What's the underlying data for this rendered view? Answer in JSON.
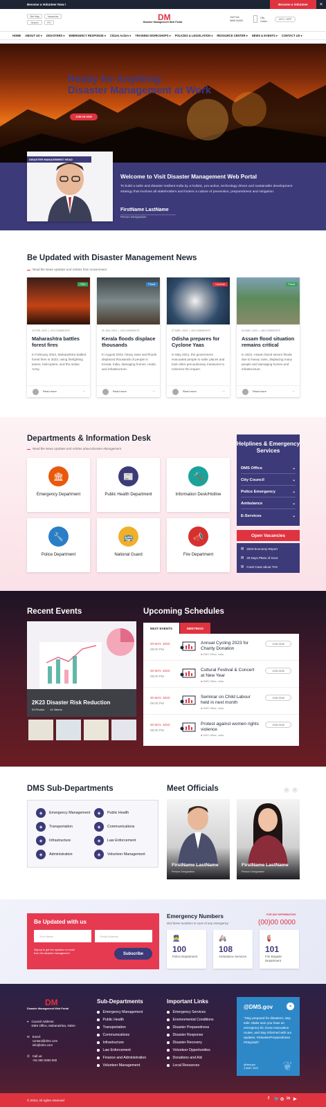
{
  "topbar": {
    "message": "Become a Volunteer Now !",
    "volunteer_btn": "Become a Volunteer",
    "close": "✕"
  },
  "header": {
    "buttons": [
      "Site Map",
      "Vacancies",
      "Search",
      "RTI"
    ],
    "logo": "DM",
    "logo_sub": "Disaster Management Web Portal",
    "tollfree_label": "Toll Free",
    "tollfree_number": "0808 00000",
    "city_label": "City",
    "city_value": "Carter",
    "weather": "24°C / 33°F"
  },
  "nav": [
    "HOME",
    "ABOUT US ▾",
    "DISASTERS ▾",
    "EMERGENCY RESPONSE ▾",
    "Citizen Action ▾",
    "TRAINING WORKSHOPS ▾",
    "POLICIES & LEGISLATION ▾",
    "RESOURCE CENTER ▾",
    "NEWS & EVENTS ▾",
    "CONTACT US ▾"
  ],
  "hero": {
    "line1": "Ready for Anything:",
    "line2": "Disaster Management at Work",
    "cta": "JOIN US NOW"
  },
  "head": {
    "tag": "DISASTER MANAGEMENT HEAD",
    "title": "Welcome to Visit Disaster Management Web Portal",
    "text": "To build a safer and disaster resilient India by a holistic, pro-active, technology driven and sustainable development strategy that involves all stakeholders and fosters a culture of prevention, preparedness and mitigation.",
    "name": "FirstName LastName",
    "designation": "Person Designation"
  },
  "news": {
    "title": "Be Updated with Disaster Management News",
    "subtitle": "Read the News Updates and Articles from Government",
    "items": [
      {
        "tag": "Fire",
        "tag_color": "#3aa35b",
        "date": "20 FEB, 2023",
        "comments": "470 COMMENTS",
        "title": "Maharashtra battles forest fires",
        "text": "In February 2023, Maharashtra battled forest fires in 2023, using firefighting teams, helicopters, and the Indian Army.",
        "read": "Read more"
      },
      {
        "tag": "Flood",
        "tag_color": "#3a83c8",
        "date": "30 JAN, 2023",
        "comments": "225 COMMENTS",
        "title": "Kerala floods displace thousands",
        "text": "In August 2023, heavy rains and floods displaced thousands of people in Kerala, India, damaging homes, roads, and infrastructure.",
        "read": "Read more"
      },
      {
        "tag": "Cyclone",
        "tag_color": "#e03340",
        "date": "27 MAR, 2023",
        "comments": "434 COMMENTS",
        "title": "Odisha prepares for Cyclone Yaas",
        "text": "In May 2021, the government evacuated people to safer places and took other precautionary measures to minimize the impact.",
        "read": "Read more"
      },
      {
        "tag": "Flood",
        "tag_color": "#3aa35b",
        "date": "09 MAR, 2023",
        "comments": "480 COMMENTS",
        "title": "Assam flood situation remains critical",
        "text": "In 2021, Assam faced severe floods due to heavy rains, displacing many people and damaging homes and infrastructure.",
        "read": "Read more"
      }
    ]
  },
  "departments": {
    "title": "Departments & Information Desk",
    "subtitle": "Read the News Updates and Articles about Disaster Management",
    "items": [
      {
        "name": "Emergency Department",
        "color": "#e8590c",
        "icon": "🏛"
      },
      {
        "name": "Public Health Department",
        "color": "#3c3a78",
        "icon": "📰"
      },
      {
        "name": "Information Desk/Hotline",
        "color": "#1aa39a",
        "icon": "🔨"
      },
      {
        "name": "Police Department",
        "color": "#2a7ec8",
        "icon": "🔧"
      },
      {
        "name": "National Guard",
        "color": "#f0b02a",
        "icon": "🚌"
      },
      {
        "name": "Fire Department",
        "color": "#d63031",
        "icon": "📣"
      }
    ]
  },
  "helplines": {
    "title": "Helplines & Emergency Services",
    "items": [
      "DMS Office",
      "City Council",
      "Police Emergency",
      "Ambulance",
      "E-Services"
    ],
    "vacancies_btn": "Open Vacancies",
    "vacancies": [
      "2023 Economy Report",
      "30 Days Plans of Govt.",
      "Court Case about TAX"
    ]
  },
  "recent": {
    "title": "Recent Events",
    "event_title": "2K23 Disaster Risk Reduction",
    "photos": "03 Photos",
    "videos": "14 Videos"
  },
  "schedules": {
    "title": "Upcoming Schedules",
    "tabs": [
      "NEXT EVENTS",
      "MEETINGS"
    ],
    "items": [
      {
        "date": "20 MAY, 2023",
        "time": "09:00 PM",
        "title": "Annual Cycling 2023 for Charity Donation",
        "loc": "DMS Office, India",
        "btn": "JOIN NOW"
      },
      {
        "date": "20 MAY, 2023",
        "time": "09:00 PM",
        "title": "Cultural Festival & Concert at New Year",
        "loc": "DMS Office, India",
        "btn": "JOIN NOW"
      },
      {
        "date": "20 MAY, 2023",
        "time": "09:00 PM",
        "title": "Seminar on Child Labour held in next month",
        "loc": "DMS Office, India",
        "btn": "JOIN NOW"
      },
      {
        "date": "20 MAY, 2023",
        "time": "09:00 PM",
        "title": "Protest against women rights violence",
        "loc": "DMS Office, India",
        "btn": "JOIN NOW"
      }
    ]
  },
  "subdepts": {
    "title": "DMS Sub-Departments",
    "left": [
      "Emergency Management",
      "Transportation",
      "Infrastructure",
      "Administration"
    ],
    "right": [
      "Public Health",
      "Communications",
      "Law Enforcement",
      "Volunteer Management"
    ]
  },
  "officials": {
    "title": "Meet Officials",
    "items": [
      {
        "name": "FirstName LastName",
        "desig": "Person Designation"
      },
      {
        "name": "FirstName LastName",
        "desig": "Person Designation"
      }
    ]
  },
  "subscribe": {
    "title": "Be Updated with us",
    "name_ph": "Your Name",
    "email_ph": "Email Address",
    "note": "Signup to get the updates on email from the disaster management",
    "btn": "Subscribe"
  },
  "emergency": {
    "title": "Emergency Numbers",
    "subtitle": "Dial these numbers in case of any emergency",
    "info_label": "FOR ANY INFORMATION",
    "info_number": "(00)00 0000",
    "items": [
      {
        "num": "100",
        "label": "Police Department",
        "icon": "👮"
      },
      {
        "num": "108",
        "label": "Ambulance Services",
        "icon": "🚑"
      },
      {
        "num": "101",
        "label": "Fire Brigade Department",
        "icon": "🧯"
      }
    ]
  },
  "footer": {
    "logo": "DM",
    "logo_sub": "Disaster Management Web Portal",
    "address_label": "Council Address:",
    "address": "DMS Office, Maharashtra, INDIA",
    "email_label": "Email:",
    "email1": "contact@dms.com",
    "email2": "info@dms.com",
    "call_label": "Call us:",
    "call": "+91 000 0000 000",
    "subdepts_title": "Sub-Departments",
    "subdepts": [
      "Emergency Management",
      "Public Health",
      "Transportation",
      "Communications",
      "Infrastructure",
      "Law Enforcement",
      "Finance and Administration",
      "Volunteer Management"
    ],
    "links_title": "Important Links",
    "links": [
      "Emergency Services",
      "Environmental Conditions",
      "Disaster Preparedness",
      "Disaster Response",
      "Disaster Recovery",
      "Volunteer Opportunities",
      "Donations and Aid",
      "Local Resources"
    ],
    "twitter_handle": "@DMS.gov",
    "tweet": "\"Stay prepared for disasters, stay safe. Make sure you have an emergency kit, know evacuation routes, and stay informed with our updates. #DisasterPreparedness #StaySafe\"",
    "tweet_author": "@dms.gov",
    "tweet_date": "3 MAR, 2023",
    "copyright": "© 2023, All rights reserved"
  }
}
